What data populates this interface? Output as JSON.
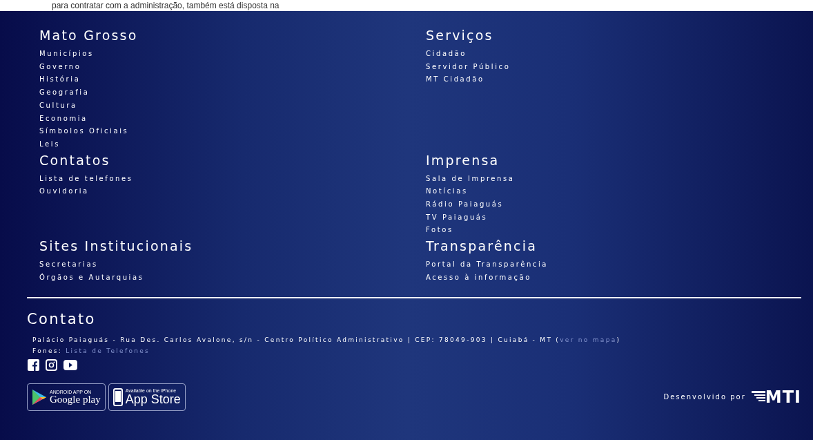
{
  "top_text": "para contratar com a administração, também está disposta na",
  "sections": [
    {
      "title": "Mato Grosso",
      "links": [
        "Municípios",
        "Governo",
        "História",
        "Geografia",
        "Cultura",
        "Economia",
        "Símbolos Oficiais",
        "Leis"
      ]
    },
    {
      "title": "Serviços",
      "links": [
        "Cidadão",
        "Servidor Público",
        "MT Cidadão"
      ]
    },
    {
      "title": "Contatos",
      "links": [
        "Lista de telefones",
        "Ouvidoria"
      ]
    },
    {
      "title": "Imprensa",
      "links": [
        "Sala de Imprensa",
        "Notícias",
        "Rádio Paiaguás",
        "TV Paiaguás",
        "Fotos"
      ]
    },
    {
      "title": "Sites Institucionais",
      "links": [
        "Secretarias",
        "Órgãos e Autarquias"
      ]
    },
    {
      "title": "Transparência",
      "links": [
        "Portal da Transparência",
        "Acesso à informação"
      ]
    }
  ],
  "contact": {
    "title": "Contato",
    "address": "Palácio Paiaguás - Rua Des. Carlos Avalone, s/n - Centro Político Administrativo | CEP: 78049-903 | Cuiabá - MT (",
    "map_link": "ver no mapa",
    "address_end": ")",
    "phones_label": "Fones:",
    "phones_link": "Lista de Telefones"
  },
  "social": [
    {
      "kind": "facebook"
    },
    {
      "kind": "instagram"
    },
    {
      "kind": "youtube"
    }
  ],
  "stores": [
    {
      "kind": "google",
      "small": "ANDROID APP ON",
      "big": "Google play"
    },
    {
      "kind": "apple",
      "small": "Available on the iPhone",
      "big": "App Store"
    }
  ],
  "credit": {
    "label": "Desenvolvido por",
    "logo": "MTI"
  }
}
